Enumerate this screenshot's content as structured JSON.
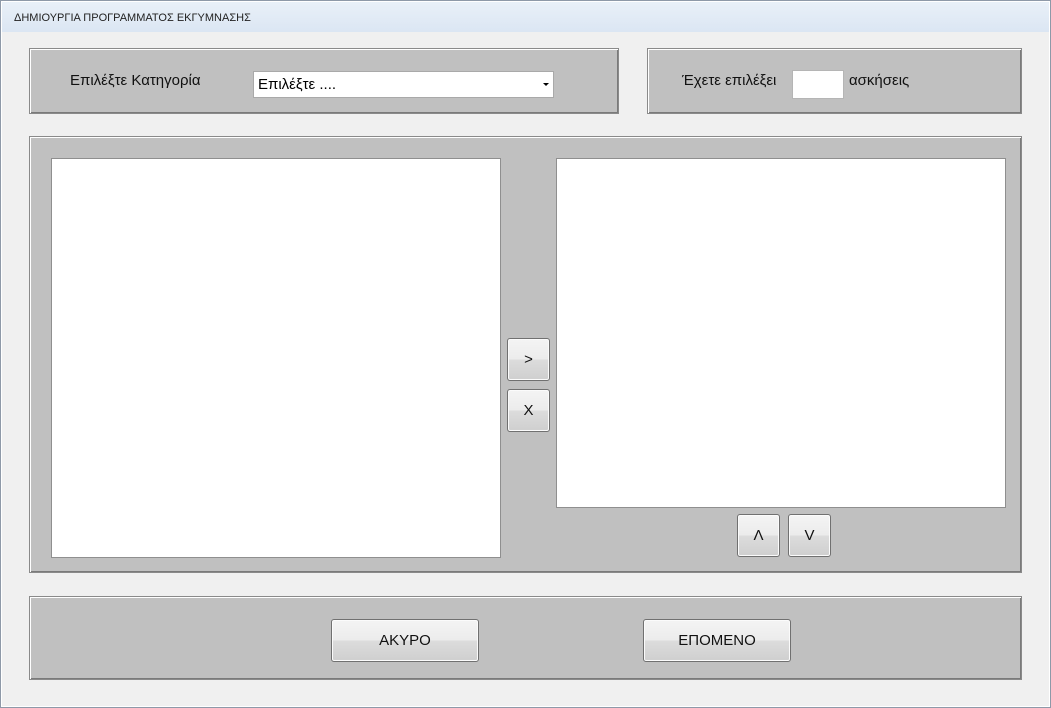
{
  "window": {
    "title": "ΔΗΜΙΟΥΡΓΙΑ ΠΡΟΓΡΑΜΜΑΤΟΣ ΕΚΓΥΜΝΑΣΗΣ"
  },
  "category": {
    "label": "Επιλέξτε Κατηγορία",
    "selected": "Επιλέξτε ...."
  },
  "counter": {
    "prefix": "Έχετε επιλέξει",
    "value": "",
    "suffix": "ασκήσεις"
  },
  "transfer": {
    "add_label": ">",
    "remove_label": "X",
    "up_label": "Λ",
    "down_label": "V"
  },
  "footer": {
    "cancel_label": "ΑΚΥΡΟ",
    "next_label": "ΕΠΟΜΕΝΟ"
  }
}
